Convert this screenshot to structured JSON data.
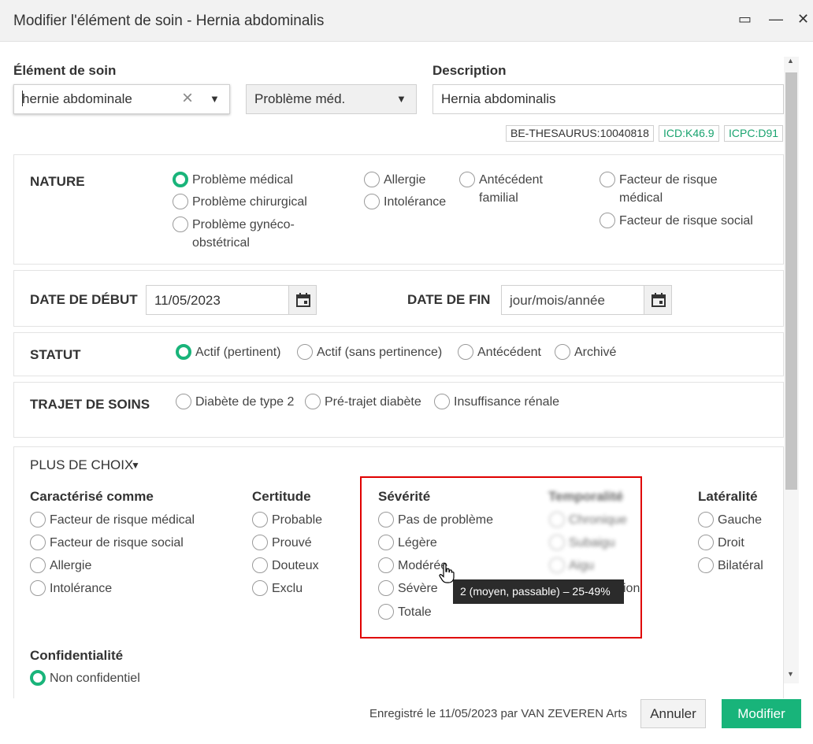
{
  "window": {
    "title": "Modifier l'élément de soin - Hernia abdominalis",
    "maximize_icon": "▭",
    "minimize_icon": "—",
    "close_icon": "✕"
  },
  "element_de_soin": {
    "label": "Élément de soin",
    "value": "hernie abdominale",
    "clear_icon": "×",
    "dropdown_icon": "▼"
  },
  "type_select": {
    "value": "Problème méd.",
    "dropdown_icon": "▼"
  },
  "description": {
    "label": "Description",
    "value": "Hernia abdominalis"
  },
  "codes": [
    "BE-THESAURUS:10040818",
    "ICD:K46.9",
    "ICPC:D91"
  ],
  "code_colors": {
    "thesaurus": "#333333",
    "icd": "#19a36f",
    "icpc": "#19a36f"
  },
  "nature": {
    "label": "NATURE",
    "options": [
      {
        "text": "Problème médical",
        "selected": true
      },
      {
        "text": "Problème chirurgical",
        "selected": false
      },
      {
        "text": "Problème gynéco-",
        "text2": "obstétrical",
        "selected": false
      },
      {
        "text": "Allergie",
        "selected": false
      },
      {
        "text": "Intolérance",
        "selected": false
      },
      {
        "text": "Antécédent",
        "text2": "familial",
        "selected": false
      },
      {
        "text": "Facteur de risque",
        "text2": "médical",
        "selected": false
      },
      {
        "text": "Facteur de risque social",
        "selected": false
      }
    ]
  },
  "dates": {
    "start_label": "DATE DE DÉBUT",
    "start_value": "11/05/2023",
    "end_label": "DATE DE FIN",
    "end_placeholder": "jour/mois/année"
  },
  "statut": {
    "label": "STATUT",
    "options": [
      {
        "text": "Actif (pertinent)",
        "selected": true
      },
      {
        "text": "Actif (sans pertinence)",
        "selected": false
      },
      {
        "text": "Antécédent",
        "selected": false
      },
      {
        "text": "Archivé",
        "selected": false
      }
    ]
  },
  "trajet": {
    "label": "TRAJET DE SOINS",
    "options": [
      {
        "text": "Diabète de type 2",
        "selected": false
      },
      {
        "text": "Pré-trajet diabète",
        "selected": false
      },
      {
        "text": "Insuffisance rénale",
        "selected": false
      }
    ]
  },
  "plus": {
    "label": "PLUS DE CHOIX",
    "toggle_icon": "▼",
    "caracterise": {
      "title": "Caractérisé comme",
      "options": [
        "Facteur de risque médical",
        "Facteur de risque social",
        "Allergie",
        "Intolérance"
      ]
    },
    "certitude": {
      "title": "Certitude",
      "options": [
        "Probable",
        "Prouvé",
        "Douteux",
        "Exclu"
      ]
    },
    "severite": {
      "title": "Sévérité",
      "options": [
        "Pas de problème",
        "Légère",
        "Modérée",
        "Sévère",
        "Totale"
      ]
    },
    "temporalite": {
      "title": "Temporalité",
      "options": [
        "Chronique",
        "Subaigu",
        "Aigu"
      ],
      "partial_text": "ion"
    },
    "lateralite": {
      "title": "Latéralité",
      "options": [
        "Gauche",
        "Droit",
        "Bilatéral"
      ]
    },
    "confidentialite": {
      "title": "Confidentialité",
      "options": [
        {
          "text": "Non confidentiel",
          "selected": true
        }
      ]
    }
  },
  "tooltip": "2 (moyen, passable) – 25-49%",
  "footer": {
    "saved_text": "Enregistré le 11/05/2023 par VAN ZEVEREN Arts",
    "cancel_label": "Annuler",
    "submit_label": "Modifier"
  },
  "colors": {
    "accent": "#19b47a",
    "highlight_box": "#e00000"
  }
}
